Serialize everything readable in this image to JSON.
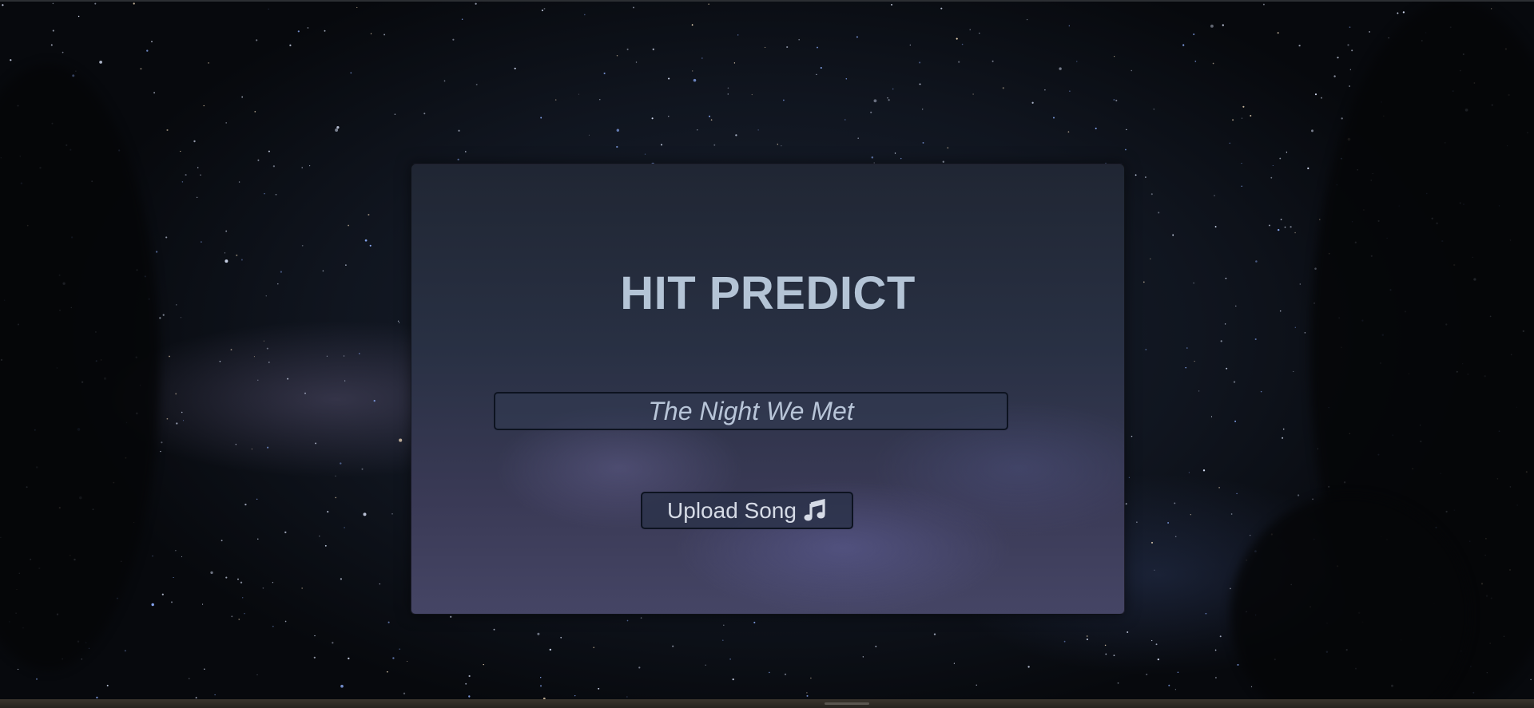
{
  "app": {
    "title": "HIT PREDICT"
  },
  "form": {
    "song_title_value": "The Night We Met",
    "upload_label": "Upload Song",
    "upload_icon": "music-note-icon"
  },
  "colors": {
    "title_text": "#b4c4d6",
    "input_text": "#b8c5d8",
    "button_text": "#d6dbe6",
    "border": "#0d1320",
    "card_top": "#202633",
    "card_bottom": "#454565"
  }
}
